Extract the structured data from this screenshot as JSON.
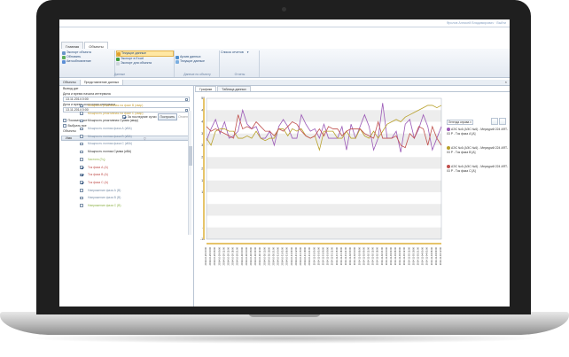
{
  "header": {
    "user": "Фролов Алексей Владимирович · Выйти"
  },
  "tabs": [
    {
      "label": "Главная"
    },
    {
      "label": "Объекты"
    }
  ],
  "ribbon": {
    "groups": [
      {
        "caption": "Данные",
        "items": [
          "Экспорт объекта",
          "Обновить",
          "Автообновление"
        ]
      },
      {
        "caption": "",
        "items": [
          "Текущие данные",
          "Экспорт в Excel",
          "Экспорт для объекта"
        ]
      },
      {
        "caption": "Данные по объекту",
        "items": [
          "Архив данных",
          "Текущие данные"
        ]
      },
      {
        "caption": "Отчеты",
        "items": [
          "Список отчетов"
        ]
      }
    ]
  },
  "doc_tabs": [
    {
      "label": "Объекты"
    },
    {
      "label": "Представление данных"
    }
  ],
  "left": {
    "result_label": "Вывод дат",
    "start_label": "Дата и время начала интервала",
    "start_value": "13.11.2014 0:00",
    "end_label": "Дата и время окончания интервала",
    "end_value": "13.11.2014 0:00",
    "last_day_label": "За последние сутки",
    "build_button": "Построить",
    "cancel_button": "Отмена",
    "show_all": "Показать все",
    "select_all": "Выбрать все",
    "objects_label": "Объекты",
    "tree_header": "Имя",
    "tree_items": [
      {
        "label": "Мощность реактивная на фазе В (квар)",
        "checked": false
      },
      {
        "label": "Мощность реактивная на фазе С (квар)",
        "checked": false
      },
      {
        "label": "Мощность реактивная Сумма (квар)",
        "checked": false
      },
      {
        "label": "Мощность полная фаза А (кВА)",
        "checked": false
      },
      {
        "label": "Мощность полная фаза В (кВА)",
        "checked": false
      },
      {
        "label": "Мощность полная фаза С (кВА)",
        "checked": false
      },
      {
        "label": "Мощность полная Сумма (кВА)",
        "checked": false
      },
      {
        "label": "Частота (Гц)",
        "checked": false
      },
      {
        "label": "Ток фаза А (А)",
        "checked": true
      },
      {
        "label": "Ток фаза В (А)",
        "checked": true
      },
      {
        "label": "Ток фаза С (А)",
        "checked": true
      },
      {
        "label": "Напряжение фаза А (В)",
        "checked": false
      },
      {
        "label": "Напряжение фаза В (В)",
        "checked": false
      },
      {
        "label": "Напряжение фаза С (В)",
        "checked": false
      }
    ]
  },
  "chart_tabs": [
    {
      "label": "Графики"
    },
    {
      "label": "Таблица данных"
    }
  ],
  "legend": {
    "selector": "Легенда справа",
    "entries": [
      {
        "label": "АЭС №6 (АЭС №6) - Меркурий 224 ART-03 P - Ток фаза А [А]",
        "color": "#9b59b6"
      },
      {
        "label": "АЭС №6 (АЭС №6) - Меркурий 224 ART-03 P - Ток фаза В [А]",
        "color": "#b8a02a"
      },
      {
        "label": "АЭС №6 (АЭС №6) - Меркурий 224 ART-03 P - Ток фаза С [А]",
        "color": "#c0504d"
      }
    ]
  },
  "chart_data": {
    "type": "line",
    "ylim": [
      -10,
      50
    ],
    "yticks": [
      -10,
      -5,
      0,
      5,
      10,
      15,
      20,
      25,
      30,
      35,
      40,
      45,
      50
    ],
    "x": [
      "2014-10-29 00:00",
      "2014-10-29 03:00",
      "2014-10-29 06:00",
      "2014-10-29 09:00",
      "2014-10-29 12:00",
      "2014-10-29 15:00",
      "2014-10-29 18:00",
      "2014-10-29 21:00",
      "2014-10-30 00:00",
      "2014-10-30 03:00",
      "2014-10-30 06:00",
      "2014-10-30 09:00",
      "2014-10-30 12:00",
      "2014-10-30 15:00",
      "2014-10-30 18:00",
      "2014-10-30 21:00",
      "2014-10-31 00:00",
      "2014-10-31 03:00",
      "2014-10-31 06:00",
      "2014-10-31 09:00",
      "2014-10-31 12:00",
      "2014-10-31 15:00",
      "2014-10-31 18:00",
      "2014-10-31 21:00",
      "2014-11-01 00:00",
      "2014-11-01 03:00",
      "2014-11-01 06:00",
      "2014-11-01 09:00",
      "2014-11-01 12:00",
      "2014-11-01 15:00",
      "2014-11-01 18:00",
      "2014-11-01 21:00",
      "2014-11-02 00:00",
      "2014-11-02 03:00",
      "2014-11-02 06:00",
      "2014-11-02 09:00",
      "2014-11-02 12:00",
      "2014-11-02 15:00",
      "2014-11-02 18:00",
      "2014-11-02 21:00",
      "2014-11-03 00:00",
      "2014-11-03 03:00",
      "2014-11-03 06:00",
      "2014-11-03 09:00",
      "2014-11-03 12:00",
      "2014-11-03 15:00",
      "2014-11-03 18:00",
      "2014-11-03 21:00",
      "2014-11-04 00:00",
      "2014-11-04 03:00",
      "2014-11-04 06:00",
      "2014-11-04 09:00",
      "2014-11-04 12:00"
    ],
    "series": [
      {
        "name": "Ток фаза А",
        "color": "#9b59b6",
        "values": [
          32,
          37,
          41,
          35,
          40,
          33,
          34,
          36,
          45,
          39,
          37,
          38,
          33,
          33,
          36,
          30,
          38,
          41,
          38,
          33,
          33,
          43,
          39,
          36,
          37,
          33,
          39,
          33,
          33,
          33,
          38,
          28,
          39,
          33,
          38,
          43,
          38,
          28,
          33,
          48,
          33,
          33,
          36,
          27,
          39,
          41,
          33,
          37,
          43,
          38,
          28,
          33,
          38
        ]
      },
      {
        "name": "Ток фаза В",
        "color": "#b8a02a",
        "values": [
          33,
          30,
          36,
          37,
          37,
          36,
          36,
          33,
          33,
          34,
          33,
          36,
          33,
          32,
          33,
          33,
          37,
          37,
          34,
          37,
          36,
          37,
          34,
          33,
          34,
          28,
          36,
          36,
          36,
          33,
          33,
          36,
          33,
          33,
          37,
          34,
          33,
          36,
          33,
          36,
          39,
          40,
          41,
          40,
          42,
          43,
          44,
          45,
          46,
          47,
          47,
          46,
          47
        ]
      },
      {
        "name": "Ток фаза С",
        "color": "#c0504d",
        "values": [
          38,
          36,
          37,
          36,
          35,
          34,
          33,
          43,
          37,
          38,
          37,
          40,
          38,
          36,
          36,
          34,
          37,
          36,
          38,
          40,
          39,
          36,
          34,
          33,
          34,
          37,
          34,
          38,
          37,
          37,
          34,
          36,
          37,
          37,
          37,
          35,
          34,
          33,
          40,
          33,
          33,
          33,
          34,
          30,
          29,
          35,
          33,
          38,
          37,
          30,
          38,
          33,
          30
        ]
      }
    ]
  }
}
